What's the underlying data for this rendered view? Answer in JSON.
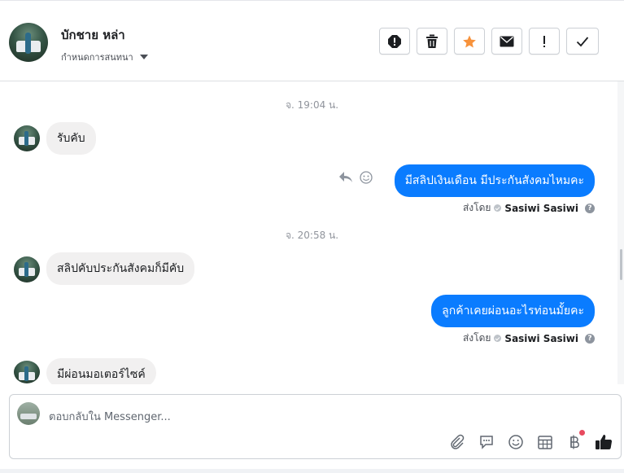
{
  "header": {
    "contact_name": "บักชาย หล่า",
    "assign_label": "กำหนดการสนทนา"
  },
  "toolbar": [
    {
      "name": "spam-button",
      "icon": "alert-circle-icon"
    },
    {
      "name": "delete-button",
      "icon": "trash-icon"
    },
    {
      "name": "star-button",
      "icon": "star-icon",
      "color": "#f7923b"
    },
    {
      "name": "mark-unread-button",
      "icon": "envelope-icon"
    },
    {
      "name": "follow-up-button",
      "icon": "exclamation-icon"
    },
    {
      "name": "done-button",
      "icon": "check-icon"
    }
  ],
  "thread": {
    "timestamp_1": "จ. 19:04 น.",
    "in_1": "รับคับ",
    "out_1": "มีสลิปเงินเดือน มีประกันสังคมไหมคะ",
    "sent_by_label": "ส่งโดย",
    "sender_name": "Sasiwi Sasiwi",
    "timestamp_2": "จ. 20:58 น.",
    "in_2": "สลิปคับประกันสังคมก็มีคับ",
    "out_2": "ลูกค้าเคยผ่อนอะไรท่อนมั้ยคะ",
    "in_3": "มีผ่อนมอเตอร์ไซค์"
  },
  "composer": {
    "placeholder": "ตอบกลับใน Messenger..."
  },
  "colors": {
    "outgoing_bubble": "#0a7cff",
    "incoming_bubble": "#f1f0f0",
    "accent_star": "#f7923b",
    "notification_dot": "#e84a5f"
  }
}
